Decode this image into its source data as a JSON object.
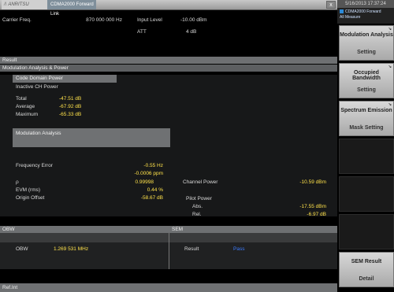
{
  "window": {
    "brand": "ANRITSU",
    "title": "CDMA2000 Forward Link",
    "close": "x"
  },
  "settings": {
    "carrier_freq_label": "Carrier Freq.",
    "carrier_freq_value": "870 000 000 Hz",
    "input_level_label": "Input Level",
    "input_level_value": "-10.00 dBm",
    "att_label": "ATT",
    "att_value": "4 dB"
  },
  "result": {
    "header": "Result",
    "section": "Modulation Analysis & Power",
    "code_domain": "Code Domain Power",
    "inactive_ch": "Inactive CH Power",
    "rows": [
      {
        "label": "Total",
        "value": "-47.51 dB"
      },
      {
        "label": "Average",
        "value": "-67.92 dB"
      },
      {
        "label": "Maximum",
        "value": "-65.33 dB"
      }
    ],
    "mod_analysis": "Modulation Analysis",
    "freq_error_label": "Frequency Error",
    "freq_error_hz": "-0.55 Hz",
    "freq_error_ppm": "-0.0006 ppm",
    "rho_label": "ρ",
    "rho_value": "0.99998",
    "evm_label": "EVM (rms)",
    "evm_value": "0.44 %",
    "origin_label": "Origin Offset",
    "origin_value": "-58.67 dB",
    "channel_power_label": "Channel Power",
    "channel_power_value": "-10.59 dBm",
    "pilot_power_label": "Pilot Power",
    "pilot_abs_label": "Abs.",
    "pilot_abs_value": "-17.55 dBm",
    "pilot_rel_label": "Rel.",
    "pilot_rel_value": "-6.97 dB"
  },
  "obw": {
    "header": "OBW",
    "label": "OBW",
    "value": "1.269 531 MHz"
  },
  "sem": {
    "header": "SEM",
    "result_label": "Result",
    "result_value": "Pass"
  },
  "ref_int": "Ref.Int",
  "side": {
    "datetime": "5/16/2013 17:37:24",
    "mode_title": "CDMA2000 Forward",
    "mode_sub": "All Measure",
    "keys": [
      {
        "line1": "Modulation Analysis",
        "line2": "Setting"
      },
      {
        "line1": "Occupied Bandwidth",
        "line2": "Setting"
      },
      {
        "line1": "Spectrum Emission",
        "line2": "Mask Setting"
      },
      {
        "line1": "SEM Result",
        "line2": "Detail"
      }
    ]
  }
}
